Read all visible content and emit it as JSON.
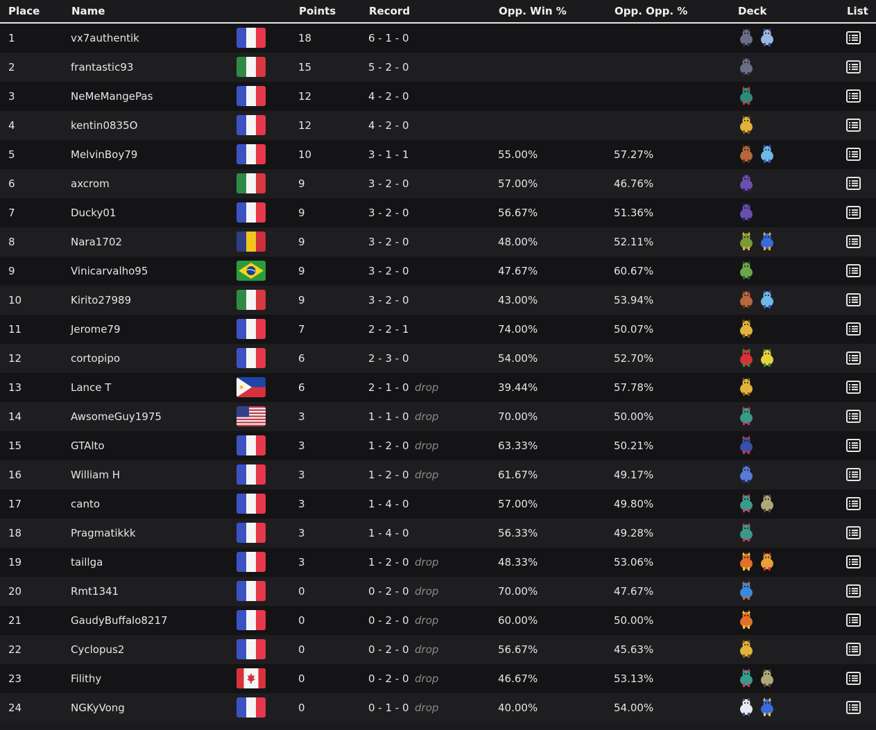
{
  "headers": {
    "place": "Place",
    "name": "Name",
    "points": "Points",
    "record": "Record",
    "opp_win": "Opp. Win %",
    "opp_opp": "Opp. Opp. %",
    "deck": "Deck",
    "list": "List"
  },
  "flags": {
    "fr": {
      "name": "France",
      "colors": [
        "#3c52c3",
        "#f5f5f5",
        "#e6384a"
      ]
    },
    "it": {
      "name": "Italy",
      "colors": [
        "#2f8a46",
        "#f5f5f5",
        "#d8383f"
      ]
    },
    "ro": {
      "name": "Romania",
      "colors": [
        "#2f3d83",
        "#f2c41c",
        "#d02e3a"
      ]
    },
    "br": {
      "name": "Brazil",
      "colors": [
        "#2c9a3d",
        "#f6d41b",
        "#1c3f8a"
      ]
    },
    "ph": {
      "name": "Philippines",
      "colors": [
        "#1f45a6",
        "#d8313b",
        "#f5f5f5"
      ]
    },
    "us": {
      "name": "United States",
      "colors": [
        "#c53b4a",
        "#f5f5f5",
        "#33408a"
      ]
    },
    "ca": {
      "name": "Canada",
      "colors": [
        "#d8313b",
        "#f5f5f5"
      ]
    }
  },
  "players": [
    {
      "place": "1",
      "name": "vx7authentik",
      "flag": "fr",
      "points": "18",
      "record": "6 - 1 - 0",
      "drop": "",
      "opp_win": "",
      "opp_opp": "",
      "deck": [
        "metal-beast-icon",
        "blue-beast-icon"
      ]
    },
    {
      "place": "2",
      "name": "frantastic93",
      "flag": "it",
      "points": "15",
      "record": "5 - 2 - 0",
      "drop": "",
      "opp_win": "",
      "opp_opp": "",
      "deck": [
        "metal-beast-icon"
      ]
    },
    {
      "place": "3",
      "name": "NeMeMangePas",
      "flag": "fr",
      "points": "12",
      "record": "4 - 2 - 0",
      "drop": "",
      "opp_win": "",
      "opp_opp": "",
      "deck": [
        "teal-red-creature-icon"
      ]
    },
    {
      "place": "4",
      "name": "kentin0835O",
      "flag": "fr",
      "points": "12",
      "record": "4 - 2 - 0",
      "drop": "",
      "opp_win": "",
      "opp_opp": "",
      "deck": [
        "gold-figure-icon"
      ]
    },
    {
      "place": "5",
      "name": "MelvinBoy79",
      "flag": "fr",
      "points": "10",
      "record": "3 - 1 - 1",
      "drop": "",
      "opp_win": "55.00%",
      "opp_opp": "57.27%",
      "deck": [
        "rock-beast-icon",
        "crystal-creature-icon"
      ]
    },
    {
      "place": "6",
      "name": "axcrom",
      "flag": "it",
      "points": "9",
      "record": "3 - 2 - 0",
      "drop": "",
      "opp_win": "57.00%",
      "opp_opp": "46.76%",
      "deck": [
        "purple-ghost-icon"
      ]
    },
    {
      "place": "7",
      "name": "Ducky01",
      "flag": "fr",
      "points": "9",
      "record": "3 - 2 - 0",
      "drop": "",
      "opp_win": "56.67%",
      "opp_opp": "51.36%",
      "deck": [
        "purple-ghost-icon"
      ]
    },
    {
      "place": "8",
      "name": "Nara1702",
      "flag": "ro",
      "points": "9",
      "record": "3 - 2 - 0",
      "drop": "",
      "opp_win": "48.00%",
      "opp_opp": "52.11%",
      "deck": [
        "green-ring-creature-icon",
        "blue-bird-icon"
      ]
    },
    {
      "place": "9",
      "name": "Vinicarvalho95",
      "flag": "br",
      "points": "9",
      "record": "3 - 2 - 0",
      "drop": "",
      "opp_win": "47.67%",
      "opp_opp": "60.67%",
      "deck": [
        "green-frog-icon"
      ]
    },
    {
      "place": "10",
      "name": "Kirito27989",
      "flag": "it",
      "points": "9",
      "record": "3 - 2 - 0",
      "drop": "",
      "opp_win": "43.00%",
      "opp_opp": "53.94%",
      "deck": [
        "rock-beast-icon",
        "crystal-creature-icon"
      ]
    },
    {
      "place": "11",
      "name": "Jerome79",
      "flag": "fr",
      "points": "7",
      "record": "2 - 2 - 1",
      "drop": "",
      "opp_win": "74.00%",
      "opp_opp": "50.07%",
      "deck": [
        "gold-figure-icon"
      ]
    },
    {
      "place": "12",
      "name": "cortopipo",
      "flag": "fr",
      "points": "6",
      "record": "2 - 3 - 0",
      "drop": "",
      "opp_win": "54.00%",
      "opp_opp": "52.70%",
      "deck": [
        "red-apple-creature-icon",
        "yellow-spark-creature-icon"
      ]
    },
    {
      "place": "13",
      "name": "Lance T",
      "flag": "ph",
      "points": "6",
      "record": "2 - 1 - 0",
      "drop": "drop",
      "opp_win": "39.44%",
      "opp_opp": "57.78%",
      "deck": [
        "gold-figure-icon"
      ]
    },
    {
      "place": "14",
      "name": "AwsomeGuy1975",
      "flag": "us",
      "points": "3",
      "record": "1 - 1 - 0",
      "drop": "drop",
      "opp_win": "70.00%",
      "opp_opp": "50.00%",
      "deck": [
        "serpent-dragon-icon"
      ]
    },
    {
      "place": "15",
      "name": "GTAlto",
      "flag": "fr",
      "points": "3",
      "record": "1 - 2 - 0",
      "drop": "drop",
      "opp_win": "63.33%",
      "opp_opp": "50.21%",
      "deck": [
        "shark-dragon-icon"
      ]
    },
    {
      "place": "16",
      "name": "William H",
      "flag": "fr",
      "points": "3",
      "record": "1 - 2 - 0",
      "drop": "drop",
      "opp_win": "61.67%",
      "opp_opp": "49.17%",
      "deck": [
        "blue-dragon-icon"
      ]
    },
    {
      "place": "17",
      "name": "canto",
      "flag": "fr",
      "points": "3",
      "record": "1 - 4 - 0",
      "drop": "",
      "opp_win": "57.00%",
      "opp_opp": "49.80%",
      "deck": [
        "serpent-dragon-icon",
        "stone-golem-icon"
      ]
    },
    {
      "place": "18",
      "name": "Pragmatikkk",
      "flag": "fr",
      "points": "3",
      "record": "1 - 4 - 0",
      "drop": "",
      "opp_win": "56.33%",
      "opp_opp": "49.28%",
      "deck": [
        "serpent-dragon-icon"
      ]
    },
    {
      "place": "19",
      "name": "taillga",
      "flag": "fr",
      "points": "3",
      "record": "1 - 2 - 0",
      "drop": "drop",
      "opp_win": "48.33%",
      "opp_opp": "53.06%",
      "deck": [
        "fire-dragon-icon",
        "fire-bird-icon"
      ]
    },
    {
      "place": "20",
      "name": "Rmt1341",
      "flag": "fr",
      "points": "0",
      "record": "0 - 2 - 0",
      "drop": "drop",
      "opp_win": "70.00%",
      "opp_opp": "47.67%",
      "deck": [
        "blue-croc-icon"
      ]
    },
    {
      "place": "21",
      "name": "GaudyBuffalo8217",
      "flag": "fr",
      "points": "0",
      "record": "0 - 2 - 0",
      "drop": "drop",
      "opp_win": "60.00%",
      "opp_opp": "50.00%",
      "deck": [
        "fire-dragon-icon"
      ]
    },
    {
      "place": "22",
      "name": "Cyclopus2",
      "flag": "fr",
      "points": "0",
      "record": "0 - 2 - 0",
      "drop": "drop",
      "opp_win": "56.67%",
      "opp_opp": "45.63%",
      "deck": [
        "gold-figure-icon"
      ]
    },
    {
      "place": "23",
      "name": "Filithy",
      "flag": "ca",
      "points": "0",
      "record": "0 - 2 - 0",
      "drop": "drop",
      "opp_win": "46.67%",
      "opp_opp": "53.13%",
      "deck": [
        "serpent-dragon-icon",
        "stone-golem-icon"
      ]
    },
    {
      "place": "24",
      "name": "NGKyVong",
      "flag": "fr",
      "points": "0",
      "record": "0 - 1 - 0",
      "drop": "drop",
      "opp_win": "40.00%",
      "opp_opp": "54.00%",
      "deck": [
        "white-bird-icon",
        "yellow-bird-icon"
      ]
    }
  ],
  "sprite_colors": {
    "metal-beast-icon": [
      "#6a6f86",
      "#2b2f45"
    ],
    "blue-beast-icon": [
      "#9ab6e6",
      "#3a4d86"
    ],
    "teal-red-creature-icon": [
      "#2f8a78",
      "#d8313b"
    ],
    "gold-figure-icon": [
      "#e2b23a",
      "#7a5a1a"
    ],
    "rock-beast-icon": [
      "#b8673d",
      "#5a2e1a"
    ],
    "crystal-creature-icon": [
      "#6fb8e8",
      "#3c52c3"
    ],
    "purple-ghost-icon": [
      "#6a4fb0",
      "#2b1f55"
    ],
    "green-ring-creature-icon": [
      "#7a9a3a",
      "#e2b23a"
    ],
    "blue-bird-icon": [
      "#3a6ad8",
      "#e2b23a"
    ],
    "green-frog-icon": [
      "#6aa84a",
      "#2f5a2a"
    ],
    "red-apple-creature-icon": [
      "#d8313b",
      "#3a8a3a"
    ],
    "yellow-spark-creature-icon": [
      "#e8d23a",
      "#3a8a3a"
    ],
    "serpent-dragon-icon": [
      "#3a9a8a",
      "#c53b6a"
    ],
    "shark-dragon-icon": [
      "#3a4fa8",
      "#d8313b"
    ],
    "blue-dragon-icon": [
      "#5a7ad8",
      "#1f2f6a"
    ],
    "stone-golem-icon": [
      "#b0a878",
      "#4a4a3a"
    ],
    "fire-dragon-icon": [
      "#e0702a",
      "#f0c83a"
    ],
    "fire-bird-icon": [
      "#e8a03a",
      "#d8313b"
    ],
    "blue-croc-icon": [
      "#3a8ad8",
      "#e05a3a"
    ],
    "white-bird-icon": [
      "#e8e8f0",
      "#3a4f86"
    ],
    "yellow-bird-icon": [
      "#3a6ad8",
      "#e8c83a"
    ]
  },
  "list_icon": "list-icon"
}
